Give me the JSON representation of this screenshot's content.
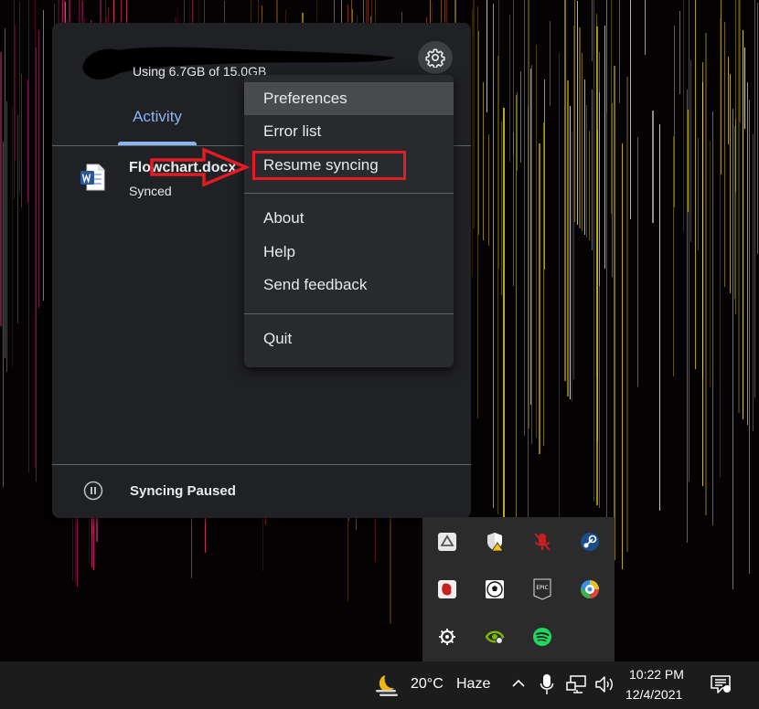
{
  "drive_panel": {
    "usage_text": "Using 6.7GB of 15.0GB",
    "tab_activity": "Activity",
    "activity_item": {
      "file_name": "Flowchart.docx",
      "status": "Synced"
    },
    "footer_status": "Syncing Paused"
  },
  "context_menu": {
    "items": [
      "Preferences",
      "Error list",
      "Resume syncing",
      "About",
      "Help",
      "Send feedback",
      "Quit"
    ]
  },
  "taskbar": {
    "weather_temp": "20°C",
    "weather_condition": "Haze",
    "clock_time": "10:22 PM",
    "clock_date": "12/4/2021"
  },
  "icons": {
    "tray": [
      "google-drive-icon",
      "windows-security-icon",
      "mic-muted-icon",
      "steam-icon",
      "bloody-mouse-icon",
      "soccer-ball-icon",
      "epic-games-icon",
      "ubisoft-icon",
      "steelseries-icon",
      "nvidia-icon",
      "spotify-icon"
    ],
    "taskbar": [
      "weather-icon",
      "chevron-up-icon",
      "microphone-icon",
      "network-icon",
      "volume-icon",
      "notification-icon"
    ]
  },
  "colors": {
    "accent": "#8ab4f8",
    "highlight": "#e31b23",
    "panel_bg": "#202124",
    "menu_bg": "#292a2d"
  }
}
